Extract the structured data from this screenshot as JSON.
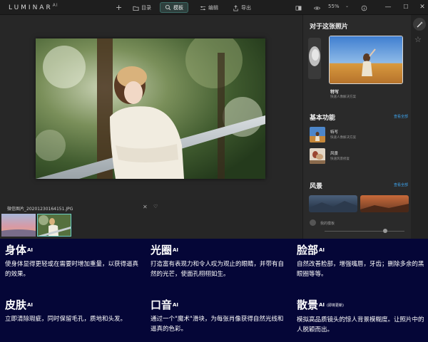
{
  "app": {
    "logo_text": "LUMINAR",
    "logo_suffix": "AI"
  },
  "toolbar": {
    "add_label": "+",
    "catalog_label": "目录",
    "templates_label": "模板",
    "edit_label": "编辑",
    "export_label": "导出",
    "zoom_label": "55%",
    "zoom_chevron": "⌄",
    "icons": [
      "plus-icon",
      "folder-icon",
      "templates-icon",
      "sliders-icon",
      "export-icon",
      "compare-icon",
      "eye-icon",
      "info-icon",
      "minimize-icon",
      "maximize-icon",
      "close-icon"
    ],
    "active_tab": "templates",
    "accent_color": "#3d6c66"
  },
  "window": {
    "minimize": "—",
    "maximize": "☐",
    "close": "✕"
  },
  "filmstrip": {
    "filename": "微信图片_20201230164151.JPG",
    "close_glyph": "✕",
    "heart_glyph": "♡",
    "selected_index": 1
  },
  "panel": {
    "about_title": "对于这张照片",
    "portrait_card_title": "特写",
    "portrait_card_sub": "快速人像解决方案",
    "essentials_title": "基本功能",
    "see_all": "查看全部",
    "features": [
      {
        "title": "特写",
        "sub": "快速人像解决方案"
      },
      {
        "title": "风景",
        "sub": "快速风景修复"
      }
    ],
    "landscape_title": "风景",
    "my_templates": "我的模板",
    "see_all_color": "#3ea5f0"
  },
  "side_strip": {
    "icons": [
      "magic-wand-icon",
      "star-icon"
    ],
    "star_glyph": "☆"
  },
  "features": [
    {
      "title": "身体",
      "sup": "AI",
      "note": "",
      "desc": "使身体显得更轻或在需要时增加重量，以获得逼真的效果。"
    },
    {
      "title": "光圈",
      "sup": "AI",
      "note": "",
      "desc": "打造富有表现力和令人叹为观止的眼睛，并带有自然的光芒，使面孔栩栩如生。"
    },
    {
      "title": "脸部",
      "sup": "AI",
      "note": "",
      "desc": "自然改善脸部，增强嘴唇，牙齿；删除多余的黑眼圈等等。"
    },
    {
      "title": "皮肤",
      "sup": "AI",
      "note": "",
      "desc": "立即清除瑕疵，同时保留毛孔，质地和头发。"
    },
    {
      "title": "口音",
      "sup": "AI",
      "note": "",
      "desc": "通过一个\"魔术\"滑块，为每张肖像获得自然光线和逼真的色彩。"
    },
    {
      "title": "散景",
      "sup": "AI",
      "note": "(即将更新)",
      "desc": "模拟高品质镜头的惊人背景模糊度。让照片中的人脱颖而出。"
    }
  ],
  "colors": {
    "features_bg": "#050637",
    "app_bg": "#262626"
  }
}
